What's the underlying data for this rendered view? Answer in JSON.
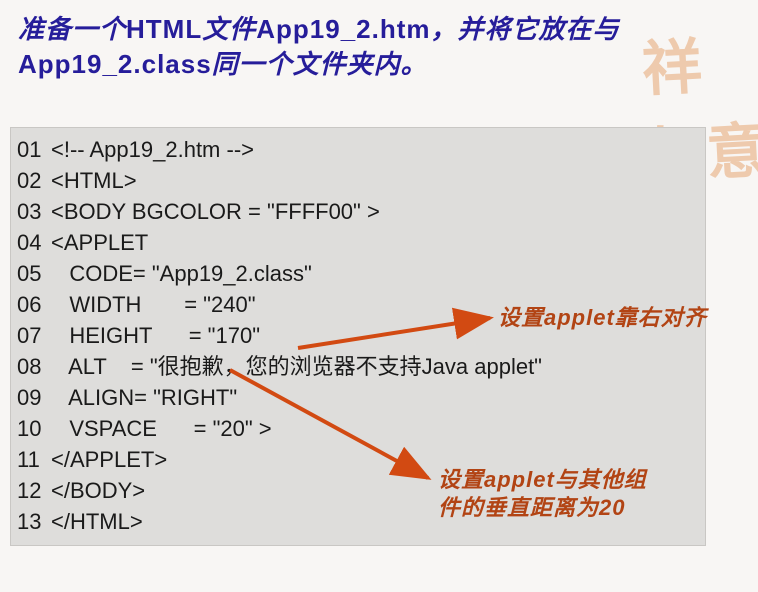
{
  "title": {
    "line1_prefix": "准备一个",
    "line1_bold": "HTML",
    "line1_mid": "文件",
    "line1_file": "App19_2.htm",
    "line1_suffix": "，并将它放在与",
    "line2_file": "App19_2.class",
    "line2_suffix": "同一个文件夹内。"
  },
  "code": {
    "lines": [
      {
        "n": "01",
        "t": "<!-- App19_2.htm -->"
      },
      {
        "n": "02",
        "t": "<HTML>"
      },
      {
        "n": "03",
        "t": "<BODY BGCOLOR = \"FFFF00\" >"
      },
      {
        "n": "04",
        "t": "<APPLET"
      },
      {
        "n": "05",
        "t": "   CODE= \"App19_2.class\""
      },
      {
        "n": "06",
        "t": "   WIDTH       = \"240\""
      },
      {
        "n": "07",
        "t": "   HEIGHT      = \"170\""
      },
      {
        "n": "08",
        "t": "   ALT    = \"很抱歉，您的浏览器不支持Java applet\""
      },
      {
        "n": "09",
        "t": "   ALIGN= \"RIGHT\""
      },
      {
        "n": "10",
        "t": "   VSPACE      = \"20\" >"
      },
      {
        "n": "11",
        "t": "</APPLET>"
      },
      {
        "n": "12",
        "t": "</BODY>"
      },
      {
        "n": "13",
        "t": "</HTML>"
      }
    ]
  },
  "annotations": {
    "a1": "设置applet靠右对齐",
    "a2": "设置applet与其他组件的垂直距离为20"
  },
  "colors": {
    "title": "#261d9a",
    "annotation": "#b24414",
    "arrow": "#d24a12",
    "codebg": "#dedddb"
  }
}
